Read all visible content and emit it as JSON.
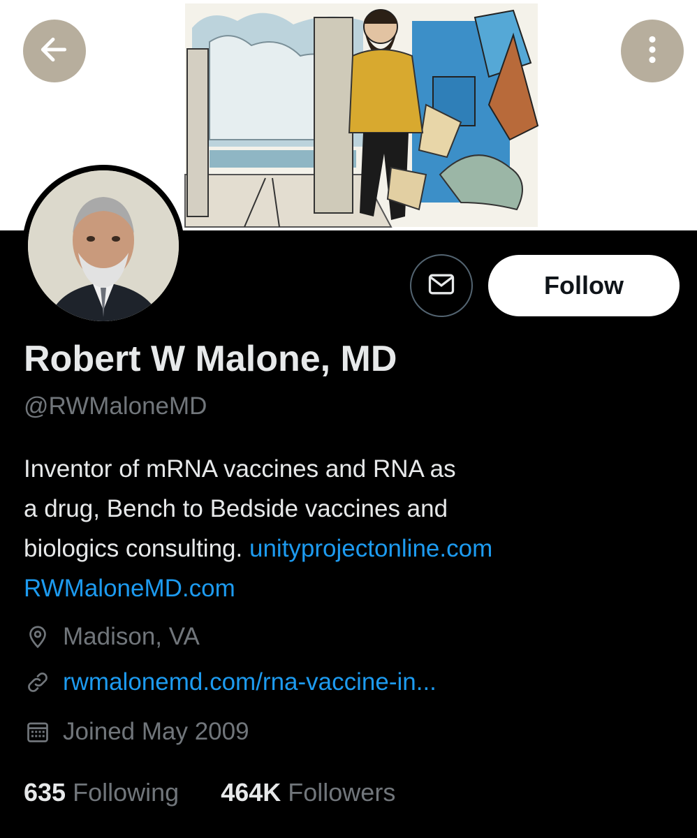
{
  "profile": {
    "display_name": "Robert W Malone, MD",
    "handle": "@RWMaloneMD",
    "bio_lines": [
      "Inventor of mRNA vaccines and RNA as",
      "a drug, Bench to Bedside vaccines and",
      "biologics consulting."
    ],
    "bio_link_1": "unityprojectonline.com",
    "bio_link_2": "RWMaloneMD.com",
    "location": "Madison, VA",
    "website": "rwmalonemd.com/rna-vaccine-in...",
    "joined": "Joined May 2009"
  },
  "actions": {
    "follow_label": "Follow"
  },
  "stats": {
    "following_count": "635",
    "following_label": "Following",
    "followers_count": "464K",
    "followers_label": "Followers"
  },
  "icons": {
    "back": "arrow-left-icon",
    "more": "more-vertical-icon",
    "message": "envelope-icon",
    "location": "location-pin-icon",
    "link": "link-icon",
    "calendar": "calendar-icon"
  },
  "colors": {
    "background": "#000000",
    "text_primary": "#e7e9ea",
    "text_secondary": "#71767b",
    "link": "#1d9bf0",
    "follow_button_bg": "#ffffff"
  }
}
